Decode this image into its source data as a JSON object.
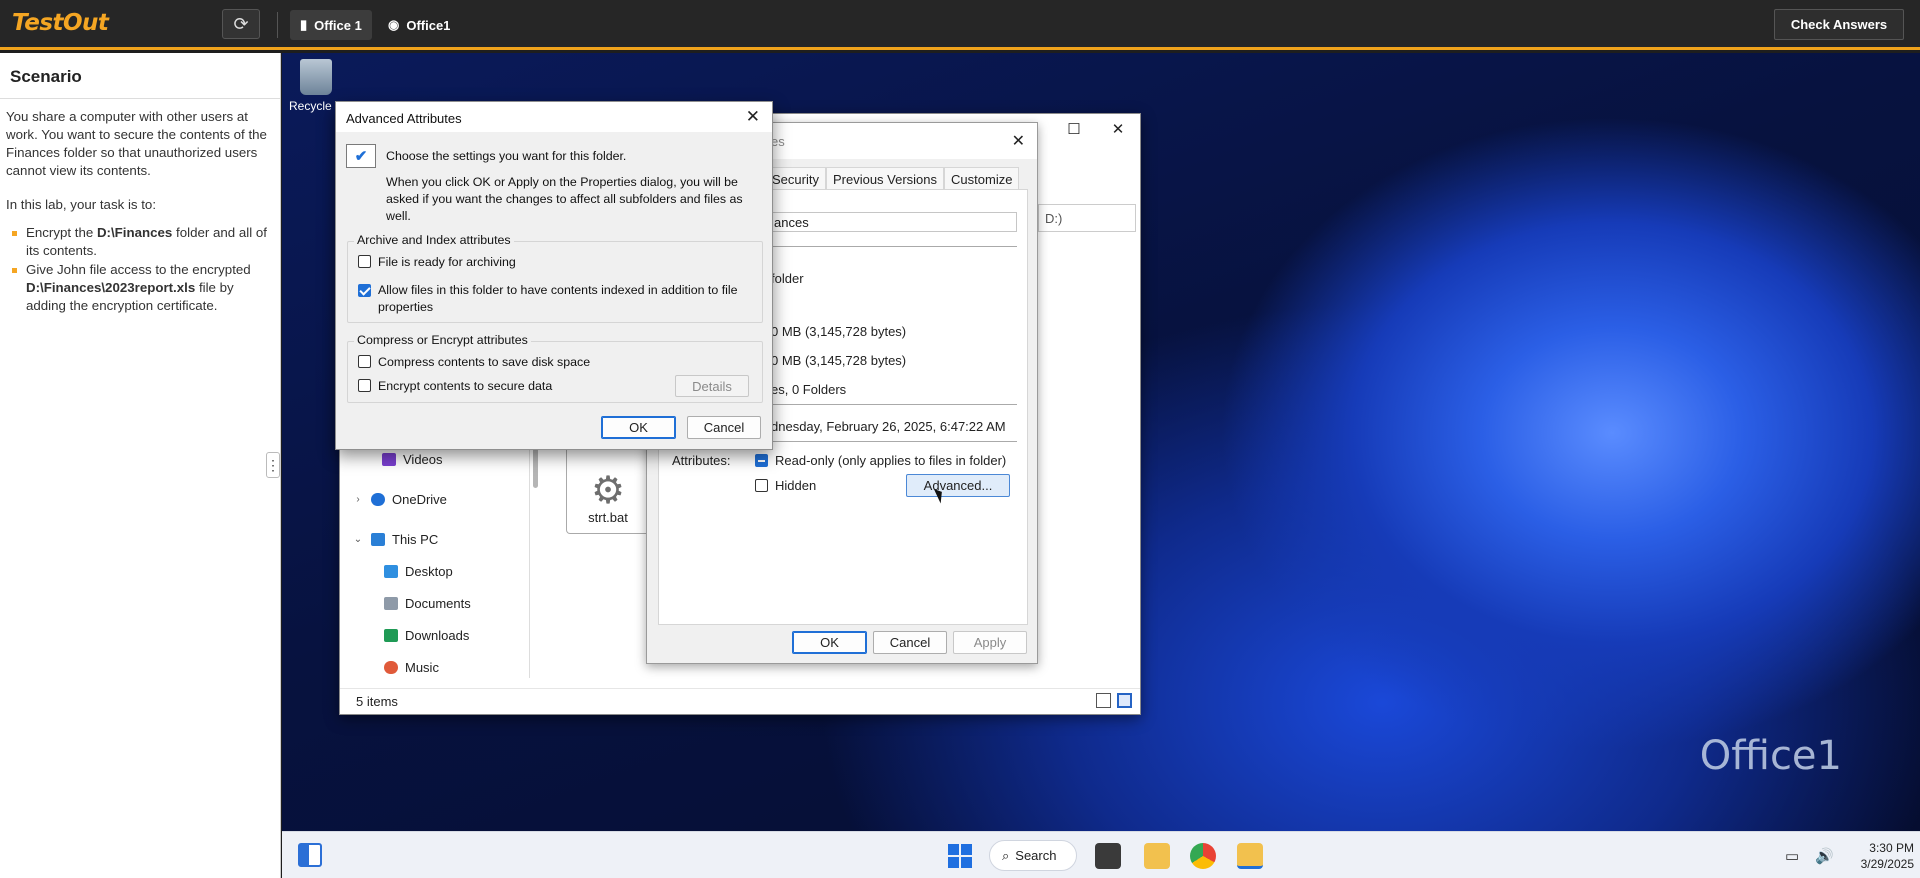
{
  "topbar": {
    "logo": "TestOut",
    "tabs": [
      {
        "label": "Office 1"
      },
      {
        "label": "Office1"
      }
    ],
    "check_answers": "Check Answers"
  },
  "scenario": {
    "title": "Scenario",
    "intro": "You share a computer with other users at work. You want to secure the contents of the Finances folder so that unauthorized users cannot view its contents.",
    "task_intro": "In this lab, your task is to:",
    "tasks": [
      {
        "pre": "Encrypt the ",
        "bold": "D:\\Finances",
        "post": " folder and all of its contents."
      },
      {
        "pre": "Give John file access to the encrypted ",
        "bold": "D:\\Finances\\2023report.xls",
        "post": " file by adding the encryption certificate."
      }
    ]
  },
  "desktop": {
    "watermark": "Office1",
    "recycle_label": "Recycle B"
  },
  "explorer": {
    "nav_items": [
      {
        "label": "Videos",
        "icon": "videos-icon",
        "color": "#7a3fd0"
      },
      {
        "label": "OneDrive",
        "icon": "onedrive-icon",
        "color": "#1f6fd6"
      },
      {
        "label": "This PC",
        "icon": "this-pc-icon",
        "color": "#2a7fd6"
      },
      {
        "label": "Desktop",
        "icon": "desktop-icon",
        "color": "#2f8fe0"
      },
      {
        "label": "Documents",
        "icon": "documents-icon",
        "color": "#8e9aa8"
      },
      {
        "label": "Downloads",
        "icon": "downloads-icon",
        "color": "#1f9a55"
      },
      {
        "label": "Music",
        "icon": "music-icon",
        "color": "#e05a3a"
      }
    ],
    "file_name": "strt.bat",
    "status": "5 items"
  },
  "properties": {
    "title_fragment": "es",
    "tabs": [
      "Security",
      "Previous Versions",
      "Customize"
    ],
    "name_value": "ances",
    "type_value": "folder",
    "size_value": "0 MB (3,145,728 bytes)",
    "size_on_disk_value": "0 MB (3,145,728 bytes)",
    "contains_value": "es, 0 Folders",
    "created_value": "dnesday, February 26, 2025, 6:47:22 AM",
    "attributes_label": "Attributes:",
    "readonly_label": "Read-only (only applies to files in folder)",
    "hidden_label": "Hidden",
    "advanced_button": "Advanced...",
    "ok": "OK",
    "cancel": "Cancel",
    "apply": "Apply",
    "side_fragment": "D:)"
  },
  "advanced": {
    "title": "Advanced Attributes",
    "header": "Choose the settings you want for this folder.",
    "description": "When you click OK or Apply on the Properties dialog, you will be asked if you want the changes to affect all subfolders and files as well.",
    "archive_group": "Archive and Index attributes",
    "archive_label": "File is ready for archiving",
    "archive_checked": false,
    "index_label": "Allow files in this folder to have contents indexed in addition to file properties",
    "index_checked": true,
    "compress_group": "Compress or Encrypt attributes",
    "compress_label": "Compress contents to save disk space",
    "compress_checked": false,
    "encrypt_label": "Encrypt contents to secure data",
    "encrypt_checked": false,
    "details": "Details",
    "ok": "OK",
    "cancel": "Cancel"
  },
  "taskbar": {
    "search": "Search",
    "time": "3:30 PM",
    "date": "3/29/2025"
  }
}
